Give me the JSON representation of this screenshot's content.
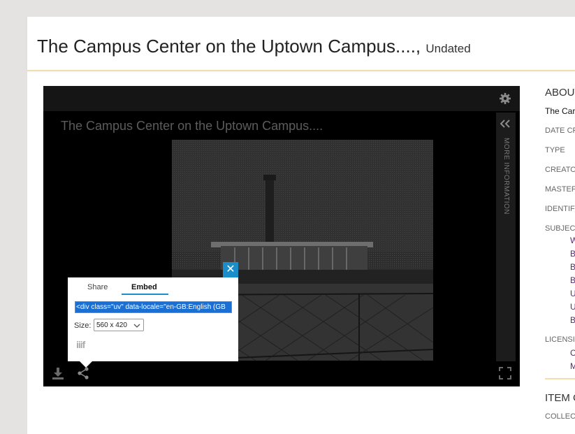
{
  "page": {
    "title": "The Campus Center on the Uptown Campus....,",
    "date": "Undated"
  },
  "viewer": {
    "label": "The Campus Center on the Uptown Campus....",
    "side_panel_label": "MORE INFORMATION",
    "icons": {
      "settings": "gear-icon",
      "collapse": "double-chevron-left-icon",
      "download": "download-icon",
      "share": "share-icon",
      "fullscreen": "fullscreen-icon"
    }
  },
  "embed_popup": {
    "tabs": [
      {
        "label": "Share",
        "active": false
      },
      {
        "label": "Embed",
        "active": true
      }
    ],
    "code": "<div class=\"uv\" data-locale=\"en-GB:English (GB",
    "size_label": "Size:",
    "size_value": "560 x 420",
    "iiif_logo": "iiif",
    "close_icon": "close-icon",
    "accent_color": "#1b8ec9"
  },
  "metadata": {
    "about_heading": "ABOUT",
    "name_value": "The Car",
    "labels": [
      "DATE CF",
      "TYPE",
      "CREATO",
      "MASTEF",
      "IDENTIF",
      "SUBJEC",
      "LICENSI",
      "COLLEC"
    ],
    "subject_values": [
      "W",
      "B",
      "B",
      "B",
      "U",
      "U",
      "B"
    ],
    "license_values": [
      "C",
      "M"
    ],
    "item_heading": "ITEM C",
    "link_color": "#5b2a6e"
  }
}
